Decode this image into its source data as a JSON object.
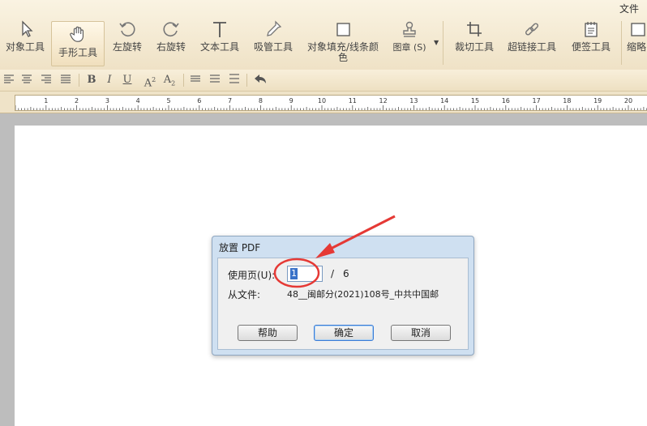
{
  "menu": {
    "file_label": "文件"
  },
  "toolbar": {
    "tools": [
      {
        "label": "对象工具",
        "icon": "cursor-arrow-icon"
      },
      {
        "label": "手形工具",
        "icon": "hand-icon",
        "active": true
      },
      {
        "label": "左旋转",
        "icon": "rotate-left-icon"
      },
      {
        "label": "右旋转",
        "icon": "rotate-right-icon"
      },
      {
        "label": "文本工具",
        "icon": "text-t-icon"
      },
      {
        "label": "吸管工具",
        "icon": "eyedropper-icon"
      },
      {
        "label": "对象填充/线条颜色",
        "icon": "fill-color-icon"
      },
      {
        "label": "图章 (S)",
        "icon": "stamp-icon"
      },
      {
        "label": "裁切工具",
        "icon": "crop-icon"
      },
      {
        "label": "超链接工具",
        "icon": "link-icon"
      },
      {
        "label": "便签工具",
        "icon": "note-icon"
      },
      {
        "label": "缩略",
        "icon": "thumbnail-icon"
      }
    ]
  },
  "format_toolbar": {
    "items": [
      "align-left-icon",
      "align-center-icon",
      "align-right-icon",
      "justify-icon",
      "bold-icon",
      "italic-icon",
      "underline-icon",
      "superscript-icon",
      "subscript-icon",
      "line-spacing-1-icon",
      "line-spacing-2-icon",
      "line-spacing-3-icon",
      "undo-icon"
    ],
    "bold": "B",
    "italic": "I",
    "underline": "U",
    "sup": "A",
    "sup_mark": "2",
    "sub": "A",
    "sub_mark": "2"
  },
  "ruler": {
    "labels": [
      "1",
      "2",
      "3",
      "4",
      "5",
      "6",
      "7",
      "8",
      "9",
      "10",
      "11",
      "12",
      "13",
      "14",
      "15",
      "16",
      "17",
      "18",
      "19",
      "20"
    ]
  },
  "dialog": {
    "title": "放置 PDF",
    "page_label": "使用页(U):",
    "page_value": "1",
    "separator": "/",
    "total_pages": "6",
    "from_label": "从文件:",
    "file_name": "48__闽邮分(2021)108号_中共中国邮",
    "help_button": "帮助",
    "ok_button": "确定",
    "cancel_button": "取消"
  },
  "colors": {
    "annotation": "#e53935",
    "selection": "#3a72c8"
  }
}
